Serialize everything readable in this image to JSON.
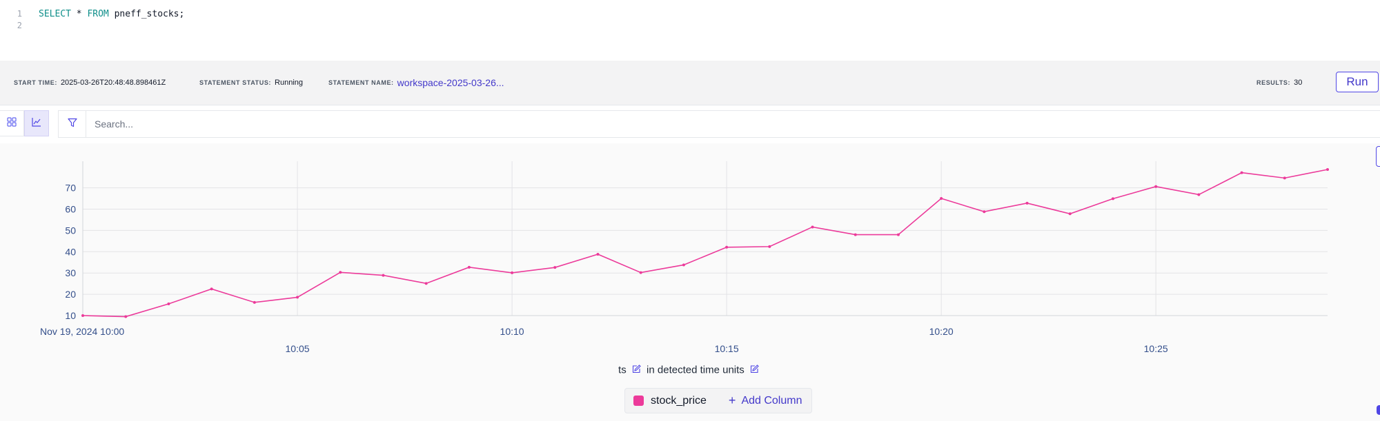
{
  "editor": {
    "lines": [
      {
        "number": "1",
        "keyword1": "SELECT",
        "middle": " * ",
        "keyword2": "FROM",
        "rest": " pneff_stocks;"
      },
      {
        "number": "2"
      }
    ]
  },
  "status": {
    "start_time_label": "START TIME:",
    "start_time": "2025-03-26T20:48:48.898461Z",
    "statement_status_label": "STATEMENT STATUS:",
    "statement_status": "Running",
    "statement_name_label": "STATEMENT NAME:",
    "statement_name": "workspace-2025-03-26...",
    "results_label": "RESULTS:",
    "results": "30",
    "run_label": "Run"
  },
  "toolbar": {
    "search_placeholder": "Search..."
  },
  "icons": {
    "grid_view": "grid-icon",
    "chart_view": "chart-icon",
    "filter": "filter-icon",
    "edit": "edit-icon",
    "plus": "plus-icon"
  },
  "colors": {
    "series": "#ec3a9a",
    "accent": "#4338ca",
    "tick": "#334e8a"
  },
  "axis": {
    "x_field": "ts",
    "x_units_text": "in detected time units"
  },
  "legend": {
    "series_label": "stock_price",
    "add_column_label": "Add Column"
  },
  "chart_data": {
    "type": "line",
    "x": [
      "10:00",
      "10:01",
      "10:02",
      "10:03",
      "10:04",
      "10:05",
      "10:06",
      "10:07",
      "10:08",
      "10:09",
      "10:10",
      "10:11",
      "10:12",
      "10:13",
      "10:14",
      "10:15",
      "10:16",
      "10:17",
      "10:18",
      "10:19",
      "10:20",
      "10:21",
      "10:22",
      "10:23",
      "10:24",
      "10:25",
      "10:26",
      "10:27",
      "10:28",
      "10:29"
    ],
    "series": [
      {
        "name": "stock_price",
        "values": [
          10,
          9.5,
          15.5,
          22.5,
          16.2,
          18.6,
          30.3,
          28.9,
          25.1,
          32.7,
          30.1,
          32.6,
          38.8,
          30.2,
          33.8,
          42.1,
          42.4,
          51.6,
          48.0,
          48.0,
          65.0,
          58.8,
          62.8,
          57.8,
          64.9,
          70.6,
          66.8,
          77.1,
          74.6,
          78.6
        ]
      }
    ],
    "y_ticks": [
      10,
      20,
      30,
      40,
      50,
      60,
      70
    ],
    "x_tick_labels": [
      {
        "index": 0,
        "label": "Nov 19, 2024 10:00"
      },
      {
        "index": 5,
        "label": "10:05"
      },
      {
        "index": 10,
        "label": "10:10"
      },
      {
        "index": 15,
        "label": "10:15"
      },
      {
        "index": 20,
        "label": "10:20"
      },
      {
        "index": 25,
        "label": "10:25"
      }
    ],
    "ylim": [
      10,
      78.6
    ],
    "grid": true
  }
}
